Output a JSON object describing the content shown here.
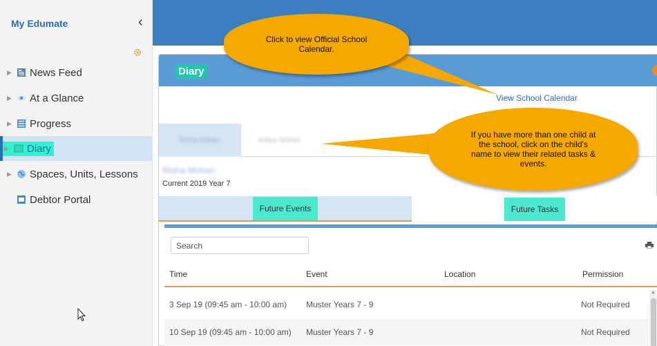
{
  "sidebar": {
    "title": "My Edumate",
    "collapse_icon": "chevron-left-icon",
    "gear_icon": "gear-icon",
    "items": [
      {
        "label": "News Feed",
        "icon": "news-feed-icon"
      },
      {
        "label": "At a Glance",
        "icon": "eye-icon"
      },
      {
        "label": "Progress",
        "icon": "progress-grid-icon"
      },
      {
        "label": "Diary",
        "icon": "diary-icon",
        "active": true
      },
      {
        "label": "Spaces, Units, Lessons",
        "icon": "globe-icon"
      },
      {
        "label": "Debtor Portal",
        "icon": "portal-icon"
      }
    ]
  },
  "panel": {
    "title": "Diary",
    "view_calendar_link": "View School Calendar",
    "children_tabs": [
      "Risha Mohan",
      "Aditya Mohan"
    ],
    "student_name": "Risha Mohan",
    "student_year": "Current 2019 Year 7",
    "subtabs": [
      "Future Events",
      "Future Tasks"
    ],
    "search_placeholder": "Search",
    "columns": [
      "Time",
      "Event",
      "Location",
      "Permission"
    ],
    "rows": [
      {
        "time": "3 Sep 19 (09:45 am - 10:00 am)",
        "event": "Muster Years 7 - 9",
        "location": "",
        "permission": "Not Required"
      },
      {
        "time": "10 Sep 19 (09:45 am - 10:00 am)",
        "event": "Muster Years 7 - 9",
        "location": "",
        "permission": "Not Required"
      }
    ]
  },
  "callouts": {
    "calendar": "Click to view Official School Calendar.",
    "children": "If you have more than one child at the school, click on the child's name to view their related tasks & events."
  },
  "colors": {
    "accent_blue": "#3c7fc0",
    "highlight_teal": "#34f0d0",
    "callout_orange": "#f5a800",
    "tab_underline": "#e29a4f"
  }
}
